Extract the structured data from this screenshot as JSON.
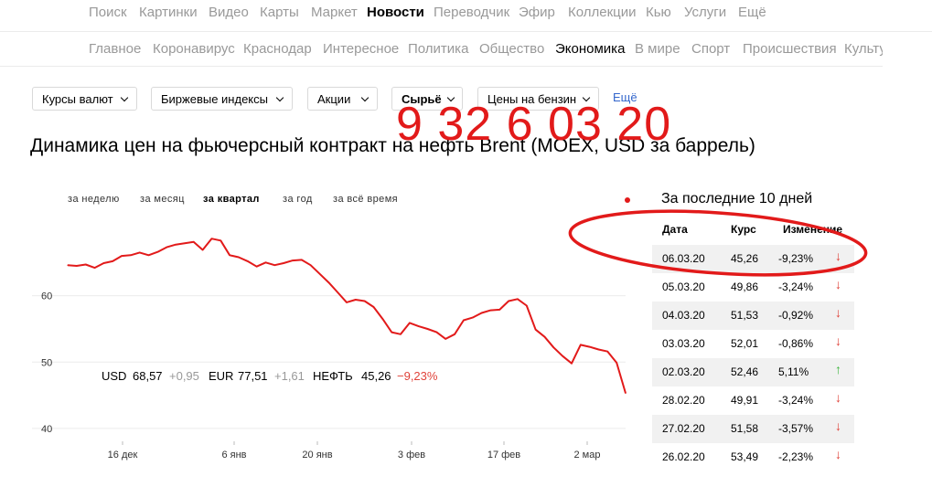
{
  "top_nav": {
    "items": [
      "Поиск",
      "Картинки",
      "Видео",
      "Карты",
      "Маркет",
      "Новости",
      "Переводчик",
      "Эфир",
      "Коллекции",
      "Кью",
      "Услуги",
      "Ещё"
    ],
    "active": "Новости"
  },
  "sub_nav": {
    "items": [
      "Главное",
      "Коронавирус",
      "Краснодар",
      "Интересное",
      "Политика",
      "Общество",
      "Экономика",
      "В мире",
      "Спорт",
      "Происшествия",
      "Культу"
    ],
    "active": "Экономика"
  },
  "category_selector": {
    "items": [
      "Курсы валют",
      "Биржевые индексы",
      "Акции",
      "Сырьё",
      "Цены на бензин"
    ],
    "selected": "Сырьё",
    "more_label": "Ещё"
  },
  "heading": "Динамика цен на фьючерсный контракт на нефть Brent (MOEX, USD за баррель)",
  "period_tabs": {
    "items": [
      "за неделю",
      "за месяц",
      "за квартал",
      "за год",
      "за всё время"
    ],
    "selected": "за квартал"
  },
  "chart_data": {
    "type": "line",
    "y_ticks": [
      "60",
      "50",
      "40"
    ],
    "ylim": [
      38.2,
      70
    ],
    "x_ticks": [
      "16 дек",
      "6 янв",
      "20 янв",
      "3 фев",
      "17 фев",
      "2 мар"
    ],
    "grid": "horizontal",
    "series": [
      {
        "color": "#e21a1a",
        "values": [
          64.6,
          64.5,
          64.7,
          64.2,
          64.9,
          65.2,
          66.0,
          66.1,
          66.5,
          66.1,
          66.6,
          67.3,
          67.7,
          67.9,
          68.1,
          66.9,
          68.6,
          68.3,
          66.1,
          65.8,
          65.2,
          64.4,
          65.0,
          64.6,
          64.9,
          65.3,
          65.4,
          64.6,
          63.3,
          62.0,
          60.5,
          59.0,
          59.4,
          59.2,
          58.3,
          56.5,
          54.5,
          54.2,
          55.9,
          55.4,
          55.0,
          54.5,
          53.5,
          54.2,
          56.3,
          56.7,
          57.4,
          57.8,
          57.9,
          59.2,
          59.5,
          58.5,
          54.9,
          53.8,
          52.2,
          50.9,
          49.8,
          52.6,
          52.3,
          51.9,
          51.6,
          49.9,
          45.3
        ]
      }
    ]
  },
  "ticker": {
    "usd_label": "USD",
    "usd_value": "68,57",
    "usd_change": "+0,95",
    "eur_label": "EUR",
    "eur_value": "77,51",
    "eur_change": "+1,61",
    "oil_label": "НЕФТЬ",
    "oil_value": "45,26",
    "oil_change": "−9,23%"
  },
  "table": {
    "title": "За последние 10 дней",
    "headers": [
      "Дата",
      "Курс",
      "Изменение"
    ],
    "rows": [
      {
        "date": "06.03.20",
        "rate": "45,26",
        "change": "-9,23%",
        "dir": "down"
      },
      {
        "date": "05.03.20",
        "rate": "49,86",
        "change": "-3,24%",
        "dir": "down"
      },
      {
        "date": "04.03.20",
        "rate": "51,53",
        "change": "-0,92%",
        "dir": "down"
      },
      {
        "date": "03.03.20",
        "rate": "52,01",
        "change": "-0,86%",
        "dir": "down"
      },
      {
        "date": "02.03.20",
        "rate": "52,46",
        "change": "5,11%",
        "dir": "up"
      },
      {
        "date": "28.02.20",
        "rate": "49,91",
        "change": "-3,24%",
        "dir": "down"
      },
      {
        "date": "27.02.20",
        "rate": "51,58",
        "change": "-3,57%",
        "dir": "down"
      },
      {
        "date": "26.02.20",
        "rate": "53,49",
        "change": "-2,23%",
        "dir": "down"
      }
    ],
    "arrow_down": "↓",
    "arrow_up": "↑"
  },
  "annotation": {
    "handwritten_text": "9 32 6 03 20",
    "color": "#e21a1a"
  }
}
